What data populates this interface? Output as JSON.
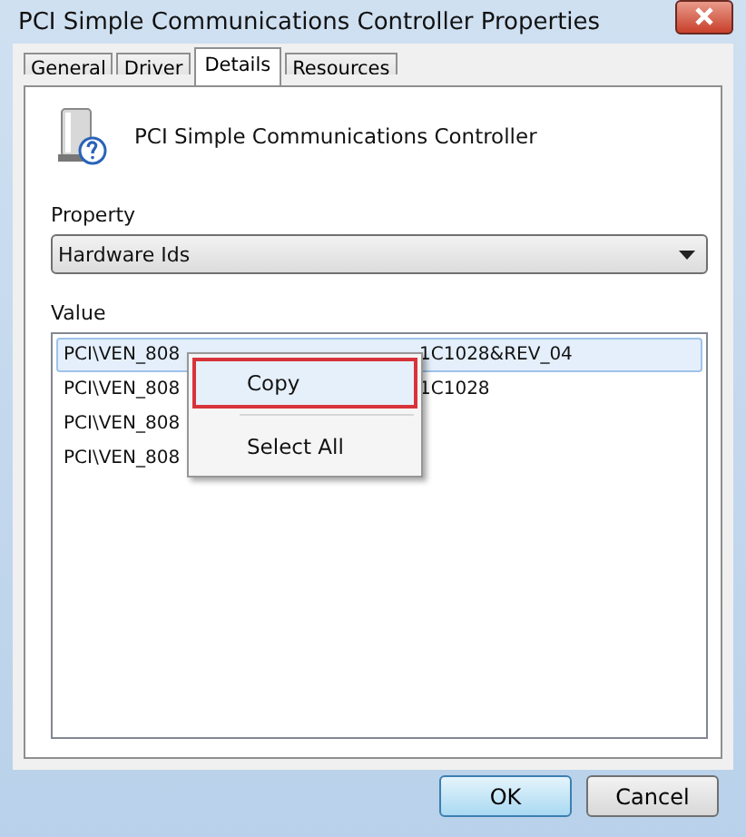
{
  "window": {
    "title": "PCI Simple Communications Controller Properties"
  },
  "tabs": [
    {
      "label": "General",
      "selected": false
    },
    {
      "label": "Driver",
      "selected": false
    },
    {
      "label": "Details",
      "selected": true
    },
    {
      "label": "Resources",
      "selected": false
    }
  ],
  "device": {
    "name": "PCI Simple Communications Controller"
  },
  "property": {
    "label": "Property",
    "value": "Hardware Ids"
  },
  "value_list": {
    "label": "Value",
    "rows": [
      {
        "start": "PCI\\VEN_808",
        "end": "1C1028&REV_04",
        "selected": true
      },
      {
        "start": "PCI\\VEN_808",
        "end": "1C1028",
        "selected": false
      },
      {
        "start": "PCI\\VEN_808",
        "selected": false
      },
      {
        "start": "PCI\\VEN_808",
        "selected": false
      }
    ]
  },
  "context_menu": [
    {
      "label": "Copy",
      "highlighted": true
    },
    {
      "label": "Select All",
      "highlighted": false
    }
  ],
  "buttons": [
    {
      "label": "OK",
      "default": true
    },
    {
      "label": "Cancel",
      "default": false
    }
  ]
}
